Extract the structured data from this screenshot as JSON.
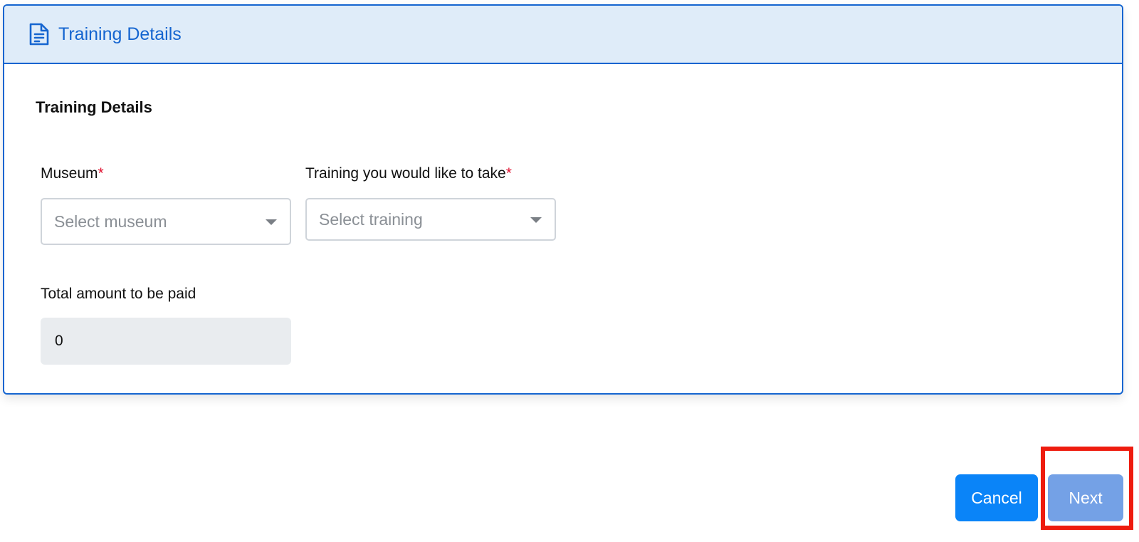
{
  "header": {
    "title": "Training Details",
    "icon": "file-text-icon"
  },
  "form": {
    "section_title": "Training Details",
    "museum": {
      "label": "Museum",
      "required_mark": "*",
      "placeholder": "Select museum"
    },
    "training": {
      "label": "Training you would like to take",
      "required_mark": "*",
      "placeholder": "Select training"
    },
    "total_amount": {
      "label": "Total amount to be paid",
      "value": "0"
    }
  },
  "actions": {
    "cancel_label": "Cancel",
    "next_label": "Next"
  },
  "colors": {
    "primary": "#1565d0",
    "header_bg": "#dfecf9",
    "cancel_bg": "#0a84f8",
    "next_bg": "#74a1e6",
    "required": "#e0102f",
    "highlight": "#ee1c0f"
  }
}
